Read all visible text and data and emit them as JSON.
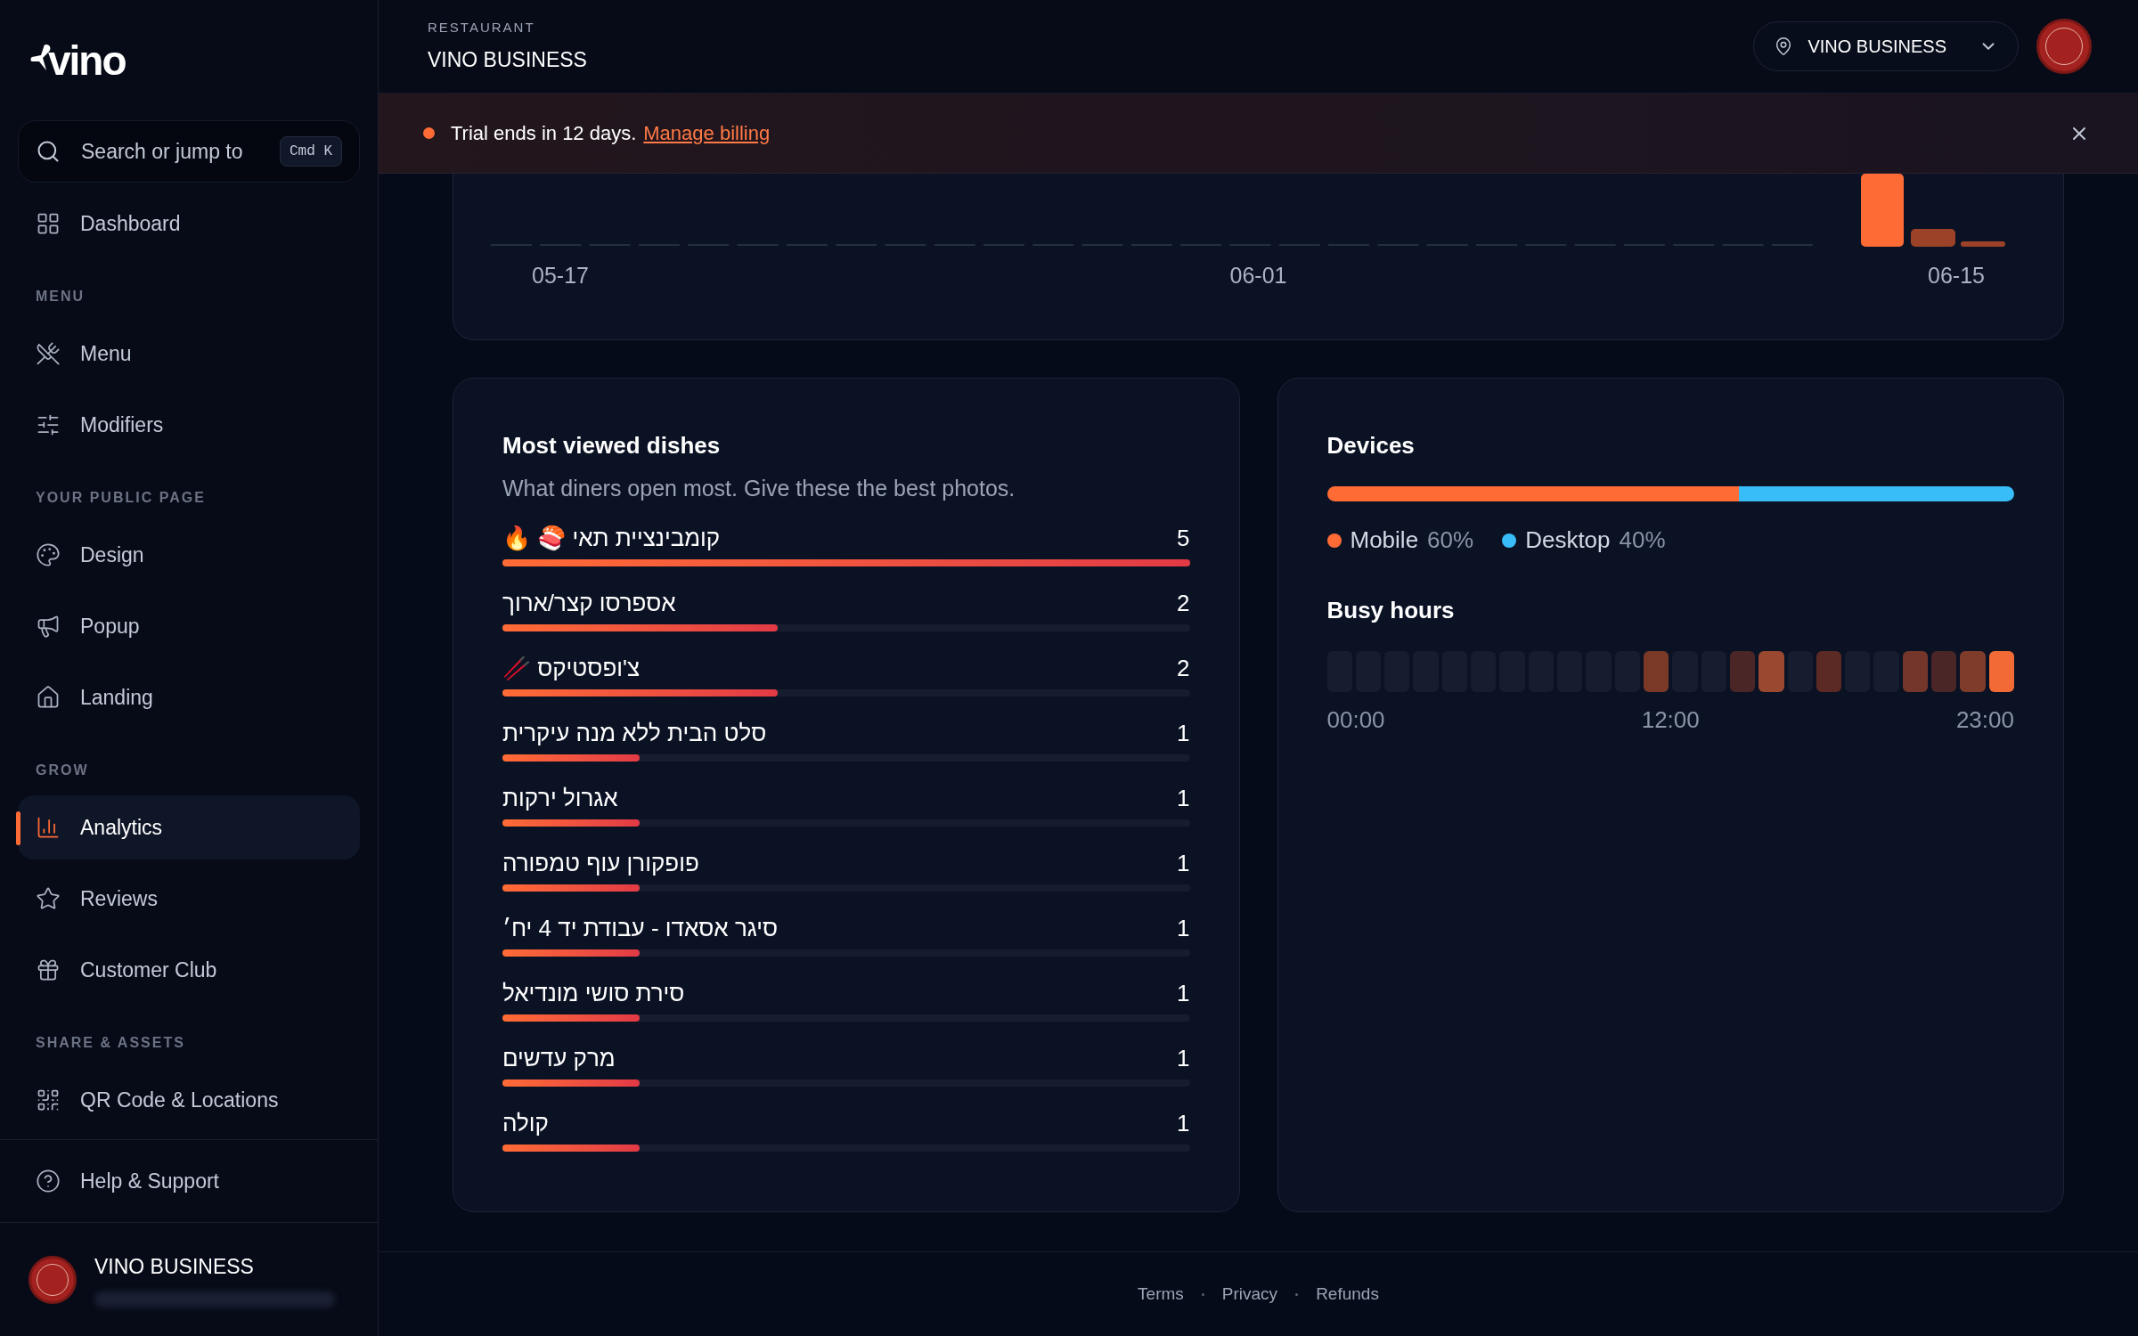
{
  "sidebar": {
    "logo": "vino",
    "search": {
      "placeholder": "Search or jump to",
      "shortcut": "Cmd K"
    },
    "sections": [
      {
        "items": [
          {
            "label": "Dashboard",
            "kind": "dashboard",
            "selected": false
          }
        ]
      },
      {
        "heading": "MENU",
        "items": [
          {
            "label": "Menu",
            "kind": "menu",
            "selected": false
          },
          {
            "label": "Modifiers",
            "kind": "modifiers",
            "selected": false
          }
        ]
      },
      {
        "heading": "YOUR PUBLIC PAGE",
        "items": [
          {
            "label": "Design",
            "kind": "design",
            "selected": false
          },
          {
            "label": "Popup",
            "kind": "popup",
            "selected": false
          },
          {
            "label": "Landing",
            "kind": "landing",
            "selected": false
          }
        ]
      },
      {
        "heading": "GROW",
        "items": [
          {
            "label": "Analytics",
            "kind": "analytics",
            "selected": true
          },
          {
            "label": "Reviews",
            "kind": "reviews",
            "selected": false
          },
          {
            "label": "Customer Club",
            "kind": "club",
            "selected": false
          }
        ]
      },
      {
        "heading": "SHARE & ASSETS",
        "items": [
          {
            "label": "QR Code & Locations",
            "kind": "qr",
            "selected": false
          }
        ]
      }
    ],
    "help": {
      "label": "Help & Support",
      "kind": "help",
      "selected": false
    },
    "user": {
      "name": "VINO BUSINESS"
    }
  },
  "header": {
    "eyebrow": "RESTAURANT",
    "title": "VINO BUSINESS",
    "location": "VINO BUSINESS"
  },
  "banner": {
    "text": "Trial ends in 12 days.",
    "link": "Manage billing"
  },
  "views_chart": {
    "x_labels": [
      "05-17",
      "06-01",
      "06-15"
    ]
  },
  "dishes": {
    "title": "Most viewed dishes",
    "subtitle": "What diners open most. Give these the best photos.",
    "rows": [
      {
        "name": "קומבינציית תאי 🍣 🔥",
        "count": "5",
        "level": 1
      },
      {
        "name": "אספרסו קצר/ארוך",
        "count": "2",
        "level": 0.4
      },
      {
        "name": "צ'ופסטיקס 🥢",
        "count": "2",
        "level": 0.4
      },
      {
        "name": "סלט הבית ללא מנה עיקרית",
        "count": "1",
        "level": 0.2
      },
      {
        "name": "אגרול ירקות",
        "count": "1",
        "level": 0.2
      },
      {
        "name": "פופקורן עוף טמפורה",
        "count": "1",
        "level": 0.2
      },
      {
        "name": "סיגר אסאדו - עבודת יד 4 יח׳",
        "count": "1",
        "level": 0.2
      },
      {
        "name": "סירת סושי מונדיאל",
        "count": "1",
        "level": 0.2
      },
      {
        "name": "מרק עדשים",
        "count": "1",
        "level": 0.2
      },
      {
        "name": "קולה",
        "count": "1",
        "level": 0.2
      }
    ]
  },
  "devices": {
    "title": "Devices",
    "segments": [
      {
        "label": "Mobile",
        "value": "60%",
        "level": 0.6,
        "color": "#ff6b35"
      },
      {
        "label": "Desktop",
        "value": "40%",
        "level": 0.4,
        "color": "#38bdf8"
      }
    ],
    "busy_title": "Busy hours",
    "hours": [
      {
        "color": "#161d2e"
      },
      {
        "color": "#161d2e"
      },
      {
        "color": "#161d2e"
      },
      {
        "color": "#161d2e"
      },
      {
        "color": "#161d2e"
      },
      {
        "color": "#161d2e"
      },
      {
        "color": "#161d2e"
      },
      {
        "color": "#161d2e"
      },
      {
        "color": "#161d2e"
      },
      {
        "color": "#161d2e"
      },
      {
        "color": "#161d2e"
      },
      {
        "color": "#7a3a27"
      },
      {
        "color": "#161d2e"
      },
      {
        "color": "#161d2e"
      },
      {
        "color": "#4a2626"
      },
      {
        "color": "#9a4830"
      },
      {
        "color": "#161d2e"
      },
      {
        "color": "#5c2a24"
      },
      {
        "color": "#161d2e"
      },
      {
        "color": "#161d2e"
      },
      {
        "color": "#74362a"
      },
      {
        "color": "#4a2626"
      },
      {
        "color": "#803c2b"
      },
      {
        "color": "#f26a35"
      }
    ],
    "hour_labels": [
      "00:00",
      "12:00",
      "23:00"
    ]
  },
  "footer": {
    "links": [
      "Terms",
      "Privacy",
      "Refunds"
    ]
  }
}
